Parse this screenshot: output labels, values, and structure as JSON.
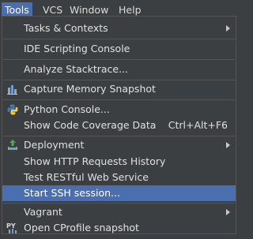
{
  "menubar": {
    "items": [
      {
        "label": "Tools",
        "active": true
      },
      {
        "label": "VCS",
        "active": false
      },
      {
        "label": "Window",
        "active": false
      },
      {
        "label": "Help",
        "active": false
      }
    ]
  },
  "menu": {
    "items": [
      {
        "label": "Tasks & Contexts",
        "submenu": true
      },
      {
        "label": "IDE Scripting Console"
      },
      {
        "label": "Analyze Stacktrace..."
      },
      {
        "label": "Capture Memory Snapshot",
        "icon": "memory-snapshot-icon"
      },
      {
        "label": "Python Console...",
        "icon": "python-icon"
      },
      {
        "label": "Show Code Coverage Data",
        "shortcut": "Ctrl+Alt+F6"
      },
      {
        "label": "Deployment",
        "icon": "deployment-icon",
        "submenu": true
      },
      {
        "label": "Show HTTP Requests History"
      },
      {
        "label": "Test RESTful Web Service"
      },
      {
        "label": "Start SSH session...",
        "selected": true
      },
      {
        "label": "Vagrant",
        "submenu": true
      },
      {
        "label": "Open CProfile snapshot",
        "icon": "cprofile-icon"
      }
    ]
  },
  "colors": {
    "background": "#3c3f41",
    "selection": "#4b6eaf",
    "text": "#e0e0e0",
    "separator": "#555555"
  }
}
